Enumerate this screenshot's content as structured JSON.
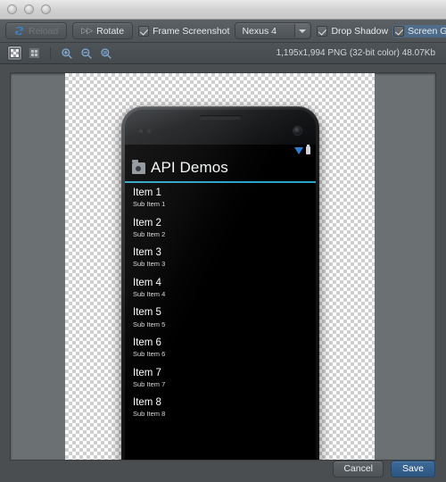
{
  "window": {
    "traffic_lights": [
      "close",
      "minimize",
      "zoom"
    ]
  },
  "toolbar": {
    "reload_label": "Reload",
    "reload_icon": "refresh-icon",
    "reload_enabled": false,
    "rotate_label": "Rotate",
    "rotate_icon": "rotate-icon",
    "frame_screenshot_label": "Frame Screenshot",
    "frame_screenshot_checked": true,
    "device_selected": "Nexus 4",
    "device_options": [
      "Nexus 4"
    ],
    "drop_shadow_label": "Drop Shadow",
    "drop_shadow_checked": true,
    "screen_glare_label": "Screen Glare",
    "screen_glare_checked": true
  },
  "viewtoolbar": {
    "transparency_icon": "checkerboard-icon",
    "grid_icon": "grid-icon",
    "zoom_in_icon": "zoom-in-icon",
    "zoom_out_icon": "zoom-out-icon",
    "zoom_actual_icon": "zoom-actual-size-icon",
    "file_info": "1,195x1,994 PNG (32-bit color) 48.07Kb"
  },
  "phone": {
    "statusbar": {
      "wifi_icon": "wifi-icon",
      "battery_icon": "battery-icon"
    },
    "app": {
      "icon": "app-folder-icon",
      "title": "API Demos"
    },
    "list": [
      {
        "title": "Item 1",
        "sub": "Sub Item 1"
      },
      {
        "title": "Item 2",
        "sub": "Sub Item 2"
      },
      {
        "title": "Item 3",
        "sub": "Sub Item 3"
      },
      {
        "title": "Item 4",
        "sub": "Sub Item 4"
      },
      {
        "title": "Item 5",
        "sub": "Sub Item 5"
      },
      {
        "title": "Item 6",
        "sub": "Sub Item 6"
      },
      {
        "title": "Item 7",
        "sub": "Sub Item 7"
      },
      {
        "title": "Item 8",
        "sub": "Sub Item 8"
      }
    ]
  },
  "footer": {
    "cancel_label": "Cancel",
    "save_label": "Save"
  },
  "colors": {
    "accent_blue": "#2a7fd4",
    "action_divider": "#2ba3c4",
    "toolbar_bg": "#4e5357",
    "canvas_bg": "#6b7073",
    "save_button": "#3c6b99"
  }
}
